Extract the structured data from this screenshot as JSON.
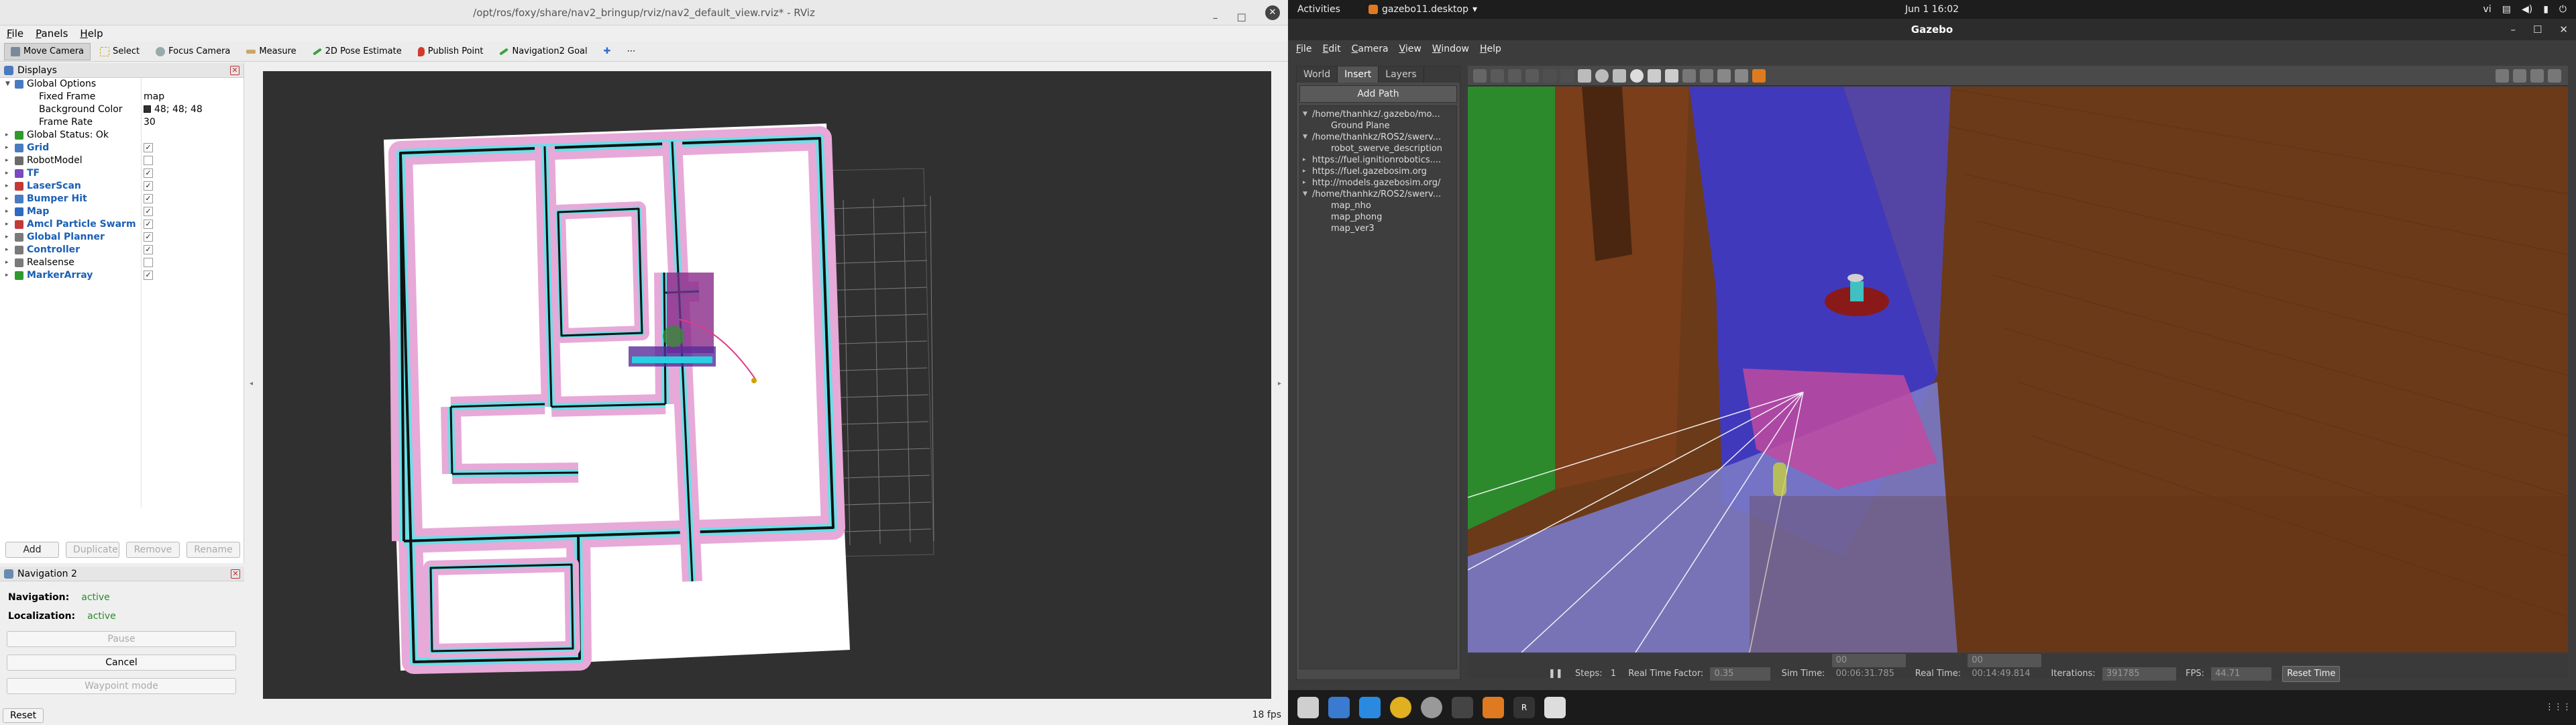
{
  "rviz": {
    "window_title": "/opt/ros/foxy/share/nav2_bringup/rviz/nav2_default_view.rviz* - RViz",
    "menu": [
      "File",
      "Panels",
      "Help"
    ],
    "toolbar": [
      "Move Camera",
      "Select",
      "Focus Camera",
      "Measure",
      "2D Pose Estimate",
      "Publish Point",
      "Navigation2 Goal"
    ],
    "displays_title": "Displays",
    "tree": [
      {
        "label": "Global Options",
        "value": "",
        "blue": false,
        "icon": "gear-icon",
        "color": "#4a7bc1",
        "indent": 1,
        "exp": "▼"
      },
      {
        "label": "Fixed Frame",
        "value": "map",
        "indent": 2,
        "exp": ""
      },
      {
        "label": "Background Color",
        "value": "48; 48; 48",
        "indent": 2,
        "exp": "",
        "swatch": "#303030"
      },
      {
        "label": "Frame Rate",
        "value": "30",
        "indent": 2,
        "exp": ""
      },
      {
        "label": "Global Status: Ok",
        "value": "",
        "indent": 1,
        "exp": "▸",
        "icon": "check-icon",
        "color": "#2e9a2e"
      },
      {
        "label": "Grid",
        "blue": true,
        "checked": true,
        "indent": 1,
        "exp": "▸",
        "icon": "grid-icon",
        "color": "#4a7bc1"
      },
      {
        "label": "RobotModel",
        "blue": false,
        "checked": false,
        "indent": 1,
        "exp": "▸",
        "icon": "robot-icon",
        "color": "#6a6a6a"
      },
      {
        "label": "TF",
        "blue": true,
        "checked": true,
        "indent": 1,
        "exp": "▸",
        "icon": "tf-icon",
        "color": "#7a4ac1"
      },
      {
        "label": "LaserScan",
        "blue": true,
        "checked": true,
        "indent": 1,
        "exp": "▸",
        "icon": "laser-icon",
        "color": "#c13a3a"
      },
      {
        "label": "Bumper Hit",
        "blue": true,
        "checked": true,
        "indent": 1,
        "exp": "▸",
        "icon": "bumper-icon",
        "color": "#4a7bc1"
      },
      {
        "label": "Map",
        "blue": true,
        "checked": true,
        "indent": 1,
        "exp": "▸",
        "icon": "map-icon",
        "color": "#2e6ac1"
      },
      {
        "label": "Amcl Particle Swarm",
        "blue": true,
        "checked": true,
        "indent": 1,
        "exp": "▸",
        "icon": "particle-icon",
        "color": "#c13a3a"
      },
      {
        "label": "Global Planner",
        "blue": true,
        "checked": true,
        "indent": 1,
        "exp": "▸",
        "icon": "folder-icon",
        "color": "#7a7a7a"
      },
      {
        "label": "Controller",
        "blue": true,
        "checked": true,
        "indent": 1,
        "exp": "▸",
        "icon": "folder-icon",
        "color": "#7a7a7a"
      },
      {
        "label": "Realsense",
        "blue": false,
        "checked": false,
        "indent": 1,
        "exp": "▸",
        "icon": "folder-icon",
        "color": "#7a7a7a"
      },
      {
        "label": "MarkerArray",
        "blue": true,
        "checked": true,
        "indent": 1,
        "exp": "▸",
        "icon": "marker-icon",
        "color": "#2e9a2e"
      }
    ],
    "buttons": [
      "Add",
      "Duplicate",
      "Remove",
      "Rename"
    ],
    "nav_title": "Navigation 2",
    "navigation_label": "Navigation:",
    "navigation_status": "active",
    "localization_label": "Localization:",
    "localization_status": "active",
    "pause": "Pause",
    "cancel": "Cancel",
    "waypoint": "Waypoint mode",
    "reset": "Reset",
    "fps": "18 fps"
  },
  "ubuntu": {
    "activities": "Activities",
    "app": "gazebo11.desktop",
    "clock": "Jun 1  16:02",
    "lang": "vi"
  },
  "gazebo": {
    "title": "Gazebo",
    "menu": [
      "File",
      "Edit",
      "Camera",
      "View",
      "Window",
      "Help"
    ],
    "tabs": [
      "World",
      "Insert",
      "Layers"
    ],
    "add_path": "Add Path",
    "tree": [
      {
        "text": "/home/thanhkz/.gazebo/mo...",
        "exp": "▼",
        "indent": 0
      },
      {
        "text": "Ground Plane",
        "exp": "",
        "indent": 1
      },
      {
        "text": "/home/thanhkz/ROS2/swerv...",
        "exp": "▼",
        "indent": 0
      },
      {
        "text": "robot_swerve_description",
        "exp": "",
        "indent": 1
      },
      {
        "text": "https://fuel.ignitionrobotics....",
        "exp": "▸",
        "indent": 0
      },
      {
        "text": "https://fuel.gazebosim.org",
        "exp": "▸",
        "indent": 0
      },
      {
        "text": "http://models.gazebosim.org/",
        "exp": "▸",
        "indent": 0
      },
      {
        "text": "/home/thanhkz/ROS2/swerv...",
        "exp": "▼",
        "indent": 0
      },
      {
        "text": "map_nho",
        "exp": "",
        "indent": 1
      },
      {
        "text": "map_phong",
        "exp": "",
        "indent": 1
      },
      {
        "text": "map_ver3",
        "exp": "",
        "indent": 1
      }
    ],
    "steps_label": "Steps:",
    "steps_value": "1",
    "rtf_label": "Real Time Factor:",
    "rtf_value": "0.35",
    "sim_label": "Sim Time:",
    "sim_value": "00 00:06:31.785",
    "real_label": "Real Time:",
    "real_value": "00 00:14:49.814",
    "iter_label": "Iterations:",
    "iter_value": "391785",
    "fps_label": "FPS:",
    "fps_value": "44.71",
    "reset_time": "Reset Time"
  }
}
